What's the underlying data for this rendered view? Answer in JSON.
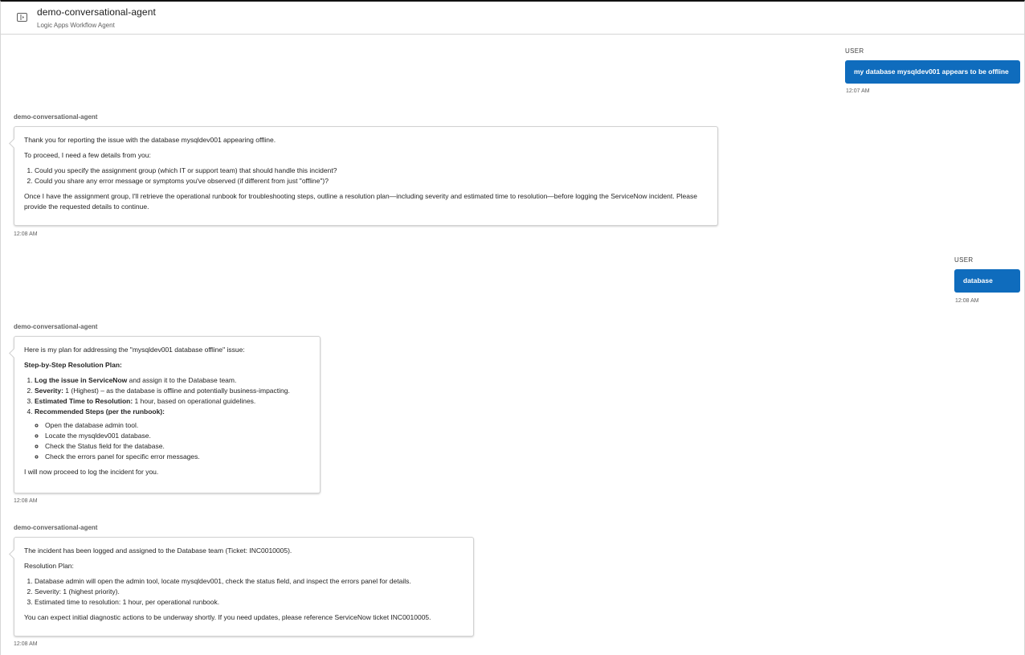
{
  "header": {
    "title": "demo-conversational-agent",
    "subtitle": "Logic Apps Workflow Agent",
    "icon": "panel-icon"
  },
  "colors": {
    "user_bubble": "#0f6cbd",
    "border": "#d1d1d1"
  },
  "messages": {
    "user1": {
      "role_label": "USER",
      "text": "my database mysqldev001 appears to be offline",
      "time": "12:07 AM"
    },
    "agent1": {
      "name": "demo-conversational-agent",
      "time": "12:08 AM",
      "intro": "Thank you for reporting the issue with the database mysqldev001 appearing offline.",
      "lead": "To proceed, I need a few details from you:",
      "items": [
        "Could you specify the assignment group (which IT or support team) that should handle this incident?",
        "Could you share any error message or symptoms you've observed (if different from just \"offline\")?"
      ],
      "outro": "Once I have the assignment group, I'll retrieve the operational runbook for troubleshooting steps, outline a resolution plan—including severity and estimated time to resolution—before logging the ServiceNow incident. Please provide the requested details to continue."
    },
    "user2": {
      "role_label": "USER",
      "text": "database",
      "time": "12:08 AM"
    },
    "agent2": {
      "name": "demo-conversational-agent",
      "time": "12:08 AM",
      "intro": "Here is my plan for addressing the \"mysqldev001 database offline\" issue:",
      "heading": "Step-by-Step Resolution Plan:",
      "steps": [
        {
          "bold": "Log the issue in ServiceNow",
          "rest": " and assign it to the Database team."
        },
        {
          "bold": "Severity:",
          "rest": " 1 (Highest) – as the database is offline and potentially business-impacting."
        },
        {
          "bold": "Estimated Time to Resolution:",
          "rest": " 1 hour, based on operational guidelines."
        },
        {
          "bold": "Recommended Steps (per the runbook):",
          "rest": ""
        }
      ],
      "substeps": [
        "Open the database admin tool.",
        "Locate the mysqldev001 database.",
        "Check the Status field for the database.",
        "Check the errors panel for specific error messages."
      ],
      "outro": "I will now proceed to log the incident for you."
    },
    "agent3": {
      "name": "demo-conversational-agent",
      "time": "12:08 AM",
      "intro": "The incident has been logged and assigned to the Database team (Ticket: INC0010005).",
      "lead": "Resolution Plan:",
      "items": [
        "Database admin will open the admin tool, locate mysqldev001, check the status field, and inspect the errors panel for details.",
        "Severity: 1 (highest priority).",
        "Estimated time to resolution: 1 hour, per operational runbook."
      ],
      "outro": "You can expect initial diagnostic actions to be underway shortly. If you need updates, please reference ServiceNow ticket INC0010005."
    }
  }
}
